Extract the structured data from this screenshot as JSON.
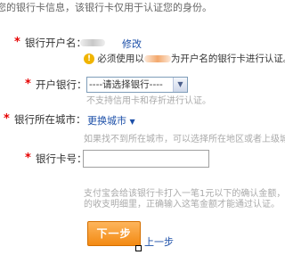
{
  "intro": "您的银行卡信息，该银行卡仅用于认证您的身份。",
  "account_name": {
    "required_mark": "*",
    "label": "银行开户名：",
    "modify_link": "修改",
    "notice_prefix": "必须使用以",
    "notice_suffix": "为开户名的银行卡进行认证。",
    "notice_bracket": "[",
    "warn_icon": "warning-icon"
  },
  "bank": {
    "required_mark": "*",
    "label": "开户银行：",
    "selected": "----请选择银行----",
    "hint": "不支持信用卡和存折进行认证。"
  },
  "city": {
    "required_mark": "*",
    "label": "银行所在城市：",
    "change_link": "更换城市",
    "hint": "如果找不到所在城市，可以选择所在地区或者上级城市"
  },
  "card_number": {
    "required_mark": "*",
    "label": "银行卡号：",
    "value": "",
    "hint_line1": "支付宝会给该银行卡打入一笔1元以下的确认金额，您",
    "hint_line2": "的收支明细里，正确输入这笔金额才能通过认证。"
  },
  "actions": {
    "next": "下一步",
    "previous": "上一步"
  }
}
